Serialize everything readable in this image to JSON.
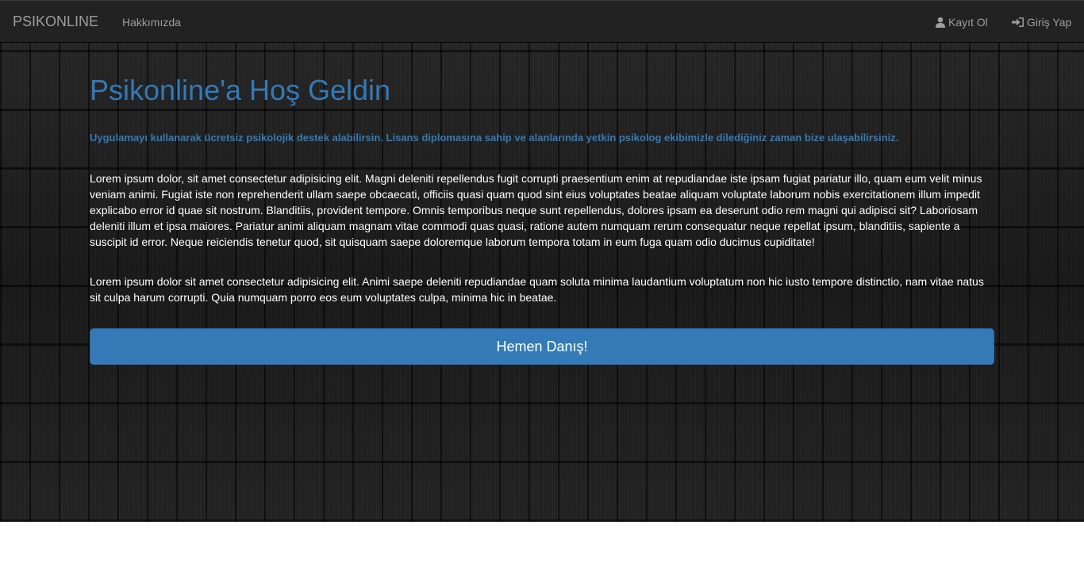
{
  "navbar": {
    "brand": "PSIKONLINE",
    "about": "Hakkımızda",
    "register": "Kayıt Ol",
    "login": "Giriş Yap"
  },
  "hero": {
    "title": "Psikonline'a Hoş Geldin",
    "lead": "Uygulamayı kullanarak ücretsiz psikolojik destek alabilirsin. Lisans diplomasına sahip ve alanlarında yetkin psikolog ekibimizle dilediğiniz zaman bize ulaşabilirsiniz.",
    "paragraph1": "Lorem ipsum dolor, sit amet consectetur adipisicing elit. Magni deleniti repellendus fugit corrupti praesentium enim at repudiandae iste ipsam fugiat pariatur illo, quam eum velit minus veniam animi. Fugiat iste non reprehenderit ullam saepe obcaecati, officiis quasi quam quod sint eius voluptates beatae aliquam voluptate laborum nobis exercitationem illum impedit explicabo error id quae sit nostrum. Blanditiis, provident tempore. Omnis temporibus neque sunt repellendus, dolores ipsam ea deserunt odio rem magni qui adipisci sit? Laboriosam deleniti illum et ipsa maiores. Pariatur animi aliquam magnam vitae commodi quas quasi, ratione autem numquam rerum consequatur neque repellat ipsum, blanditiis, sapiente a suscipit id error. Neque reiciendis tenetur quod, sit quisquam saepe doloremque laborum tempora totam in eum fuga quam odio ducimus cupiditate!",
    "paragraph2": "Lorem ipsum dolor sit amet consectetur adipisicing elit. Animi saepe deleniti repudiandae quam soluta minima laudantium voluptatum non hic iusto tempore distinctio, nam vitae natus sit culpa harum corrupti. Quia numquam porro eos eum voluptates culpa, minima hic in beatae.",
    "cta": "Hemen Danış!"
  },
  "icons": {
    "register": "user-icon",
    "login": "login-icon"
  },
  "colors": {
    "accent": "#337ab7",
    "navbar": "#222222"
  }
}
